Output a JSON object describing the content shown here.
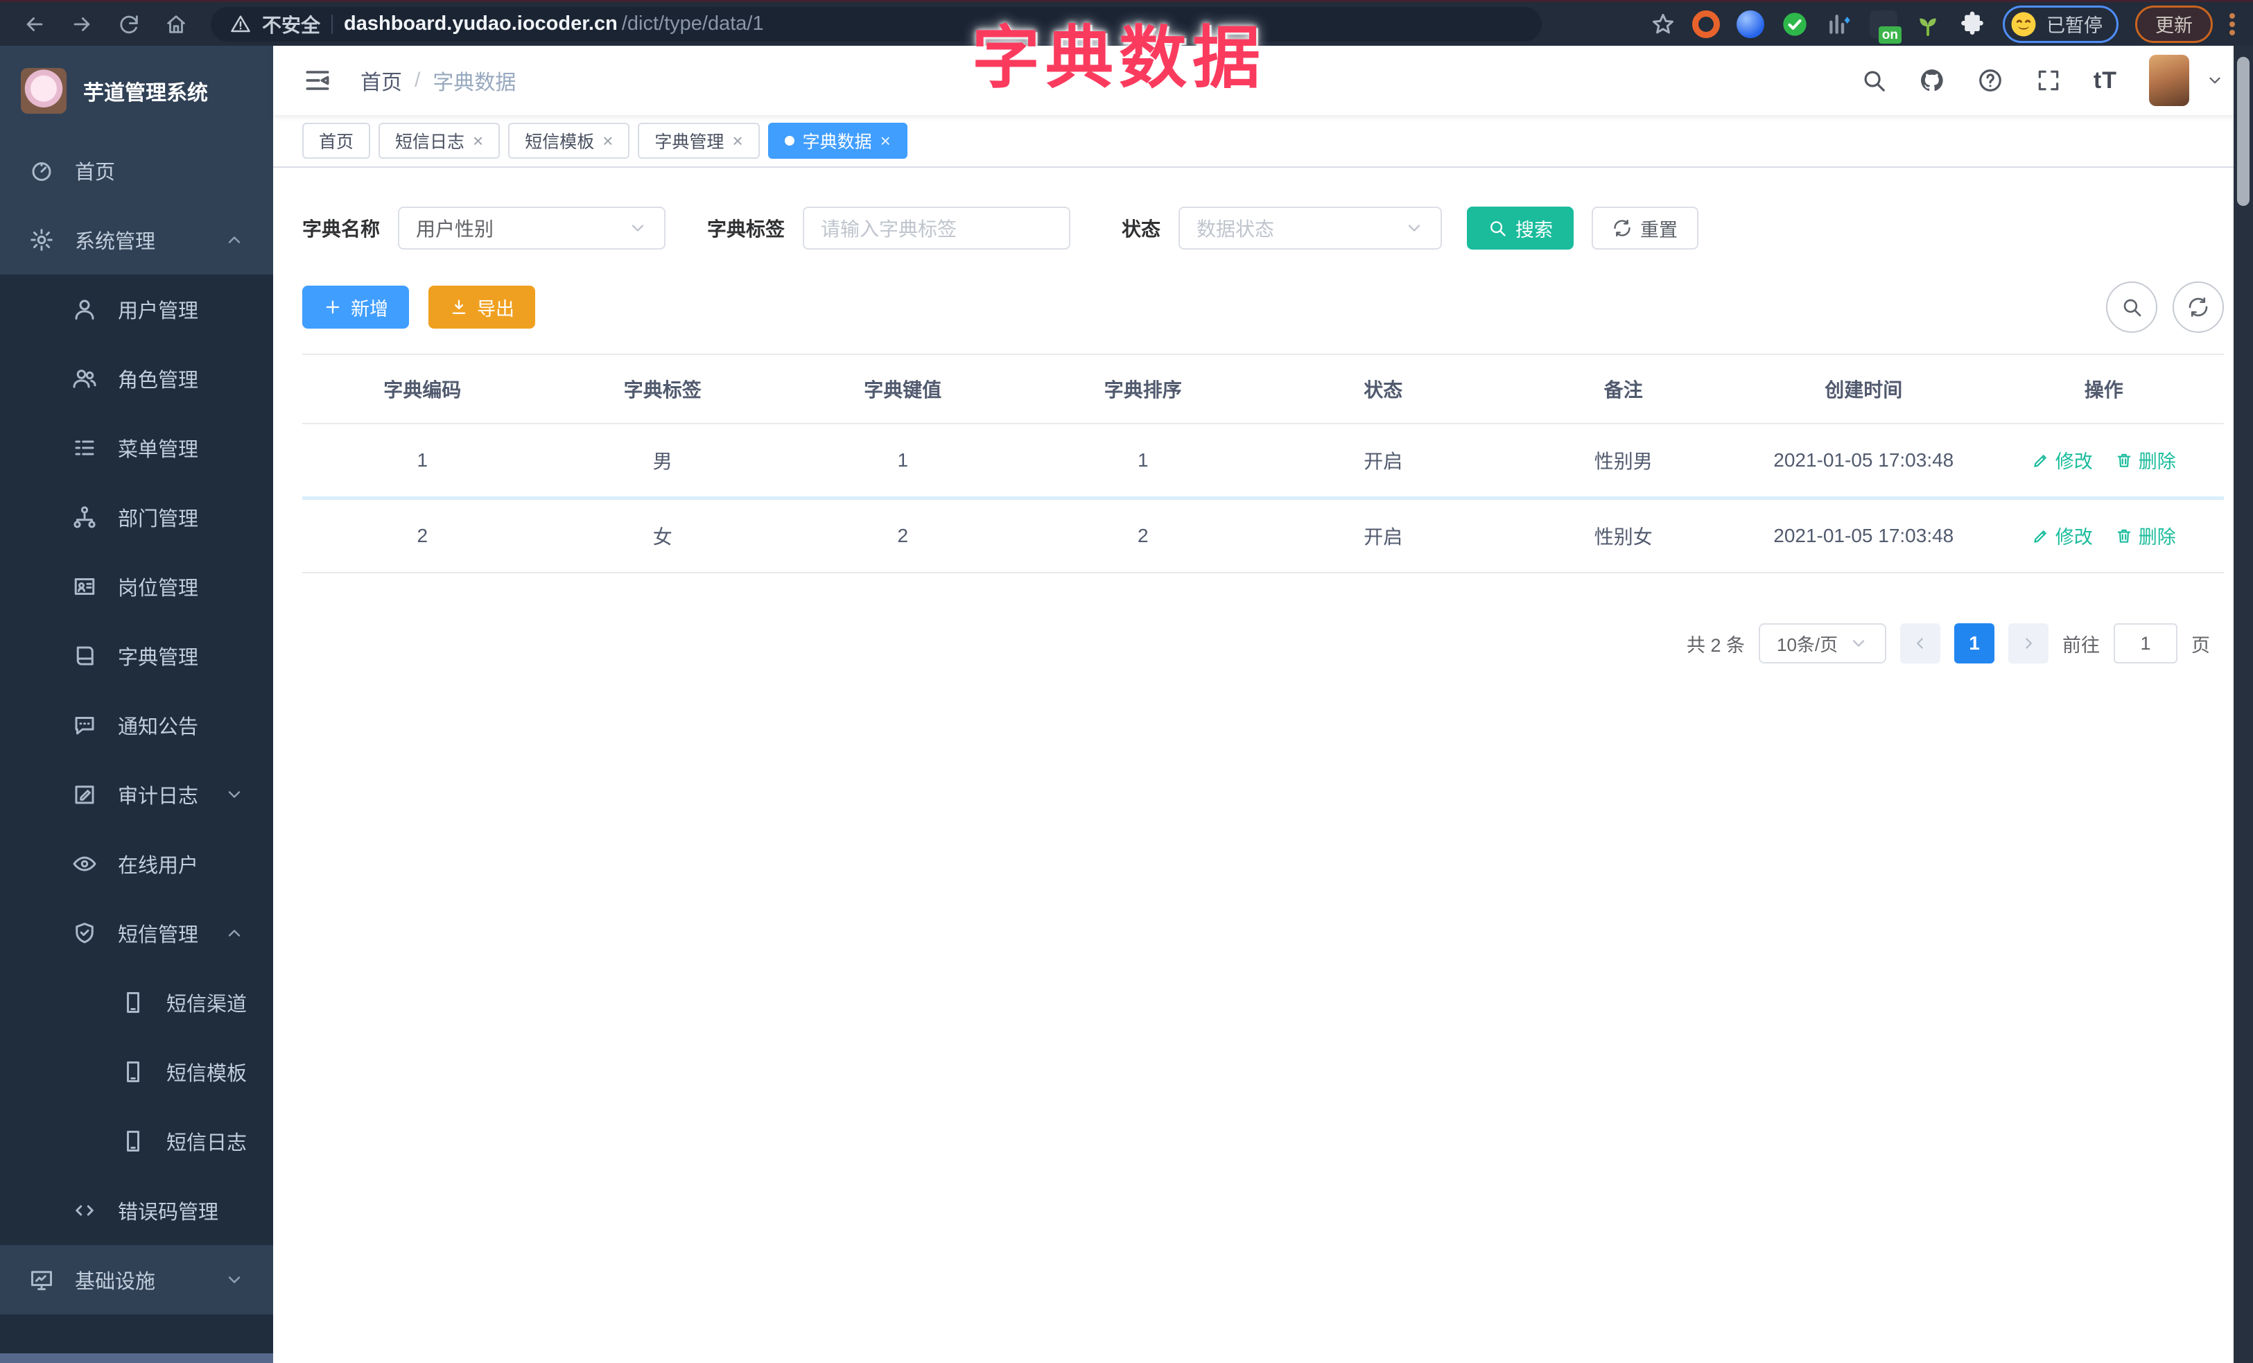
{
  "overlay_title": "字典数据",
  "browser": {
    "warning": "不安全",
    "url_domain": "dashboard.yudao.iocoder.cn",
    "url_path": "/dict/type/data/1",
    "ext_badge": "on",
    "paused": "已暂停",
    "update": "更新"
  },
  "sidebar": {
    "app_title": "芋道管理系统",
    "items": [
      {
        "label": "首页",
        "icon": "dashboard-icon",
        "level": 1
      },
      {
        "label": "系统管理",
        "icon": "gear-icon",
        "level": 1,
        "chevron": "up"
      },
      {
        "label": "用户管理",
        "icon": "user-icon",
        "level": 2
      },
      {
        "label": "角色管理",
        "icon": "users-icon",
        "level": 2
      },
      {
        "label": "菜单管理",
        "icon": "menu-list-icon",
        "level": 2
      },
      {
        "label": "部门管理",
        "icon": "org-tree-icon",
        "level": 2
      },
      {
        "label": "岗位管理",
        "icon": "id-card-icon",
        "level": 2
      },
      {
        "label": "字典管理",
        "icon": "book-icon",
        "level": 2
      },
      {
        "label": "通知公告",
        "icon": "chat-icon",
        "level": 2
      },
      {
        "label": "审计日志",
        "icon": "edit-square-icon",
        "level": 2,
        "chevron": "down"
      },
      {
        "label": "在线用户",
        "icon": "online-users-icon",
        "level": 2
      },
      {
        "label": "短信管理",
        "icon": "shield-check-icon",
        "level": 2,
        "chevron": "up"
      },
      {
        "label": "短信渠道",
        "icon": "phone-icon",
        "level": 3
      },
      {
        "label": "短信模板",
        "icon": "phone-icon",
        "level": 3
      },
      {
        "label": "短信日志",
        "icon": "phone-icon",
        "level": 3
      },
      {
        "label": "错误码管理",
        "icon": "code-icon",
        "level": 2
      },
      {
        "label": "基础设施",
        "icon": "monitor-icon",
        "level": 1,
        "chevron": "down"
      }
    ]
  },
  "navbar": {
    "breadcrumb_home": "首页",
    "breadcrumb_sep": "/",
    "breadcrumb_current": "字典数据",
    "font_icon_text": "tT"
  },
  "tabs": [
    {
      "label": "首页",
      "closable": false,
      "active": false
    },
    {
      "label": "短信日志",
      "closable": true,
      "active": false
    },
    {
      "label": "短信模板",
      "closable": true,
      "active": false
    },
    {
      "label": "字典管理",
      "closable": true,
      "active": false
    },
    {
      "label": "字典数据",
      "closable": true,
      "active": true
    }
  ],
  "filters": {
    "name_label": "字典名称",
    "name_value": "用户性别",
    "tag_label": "字典标签",
    "tag_placeholder": "请输入字典标签",
    "status_label": "状态",
    "status_placeholder": "数据状态",
    "search": "搜索",
    "reset": "重置"
  },
  "toolbar": {
    "add": "新增",
    "export": "导出"
  },
  "table": {
    "columns": [
      "字典编码",
      "字典标签",
      "字典键值",
      "字典排序",
      "状态",
      "备注",
      "创建时间",
      "操作"
    ],
    "rows": [
      {
        "cells": [
          "1",
          "男",
          "1",
          "1",
          "开启",
          "性别男",
          "2021-01-05 17:03:48"
        ]
      },
      {
        "cells": [
          "2",
          "女",
          "2",
          "2",
          "开启",
          "性别女",
          "2021-01-05 17:03:48"
        ]
      }
    ],
    "edit": "修改",
    "del": "删除"
  },
  "pagination": {
    "total": "共 2 条",
    "size": "10条/页",
    "page": "1",
    "goto": "前往",
    "goto_value": "1",
    "unit": "页"
  },
  "colors": {
    "primary": "#409eff",
    "search_teal": "#1abc9c",
    "export_orange": "#f0a020",
    "overlay_pink": "#fb3b5e",
    "sidebar_bg": "#304156",
    "sidebar_sub_bg": "#1f2d3d",
    "chrome_bg": "#222c3b",
    "pagination_active": "#2286f0"
  }
}
